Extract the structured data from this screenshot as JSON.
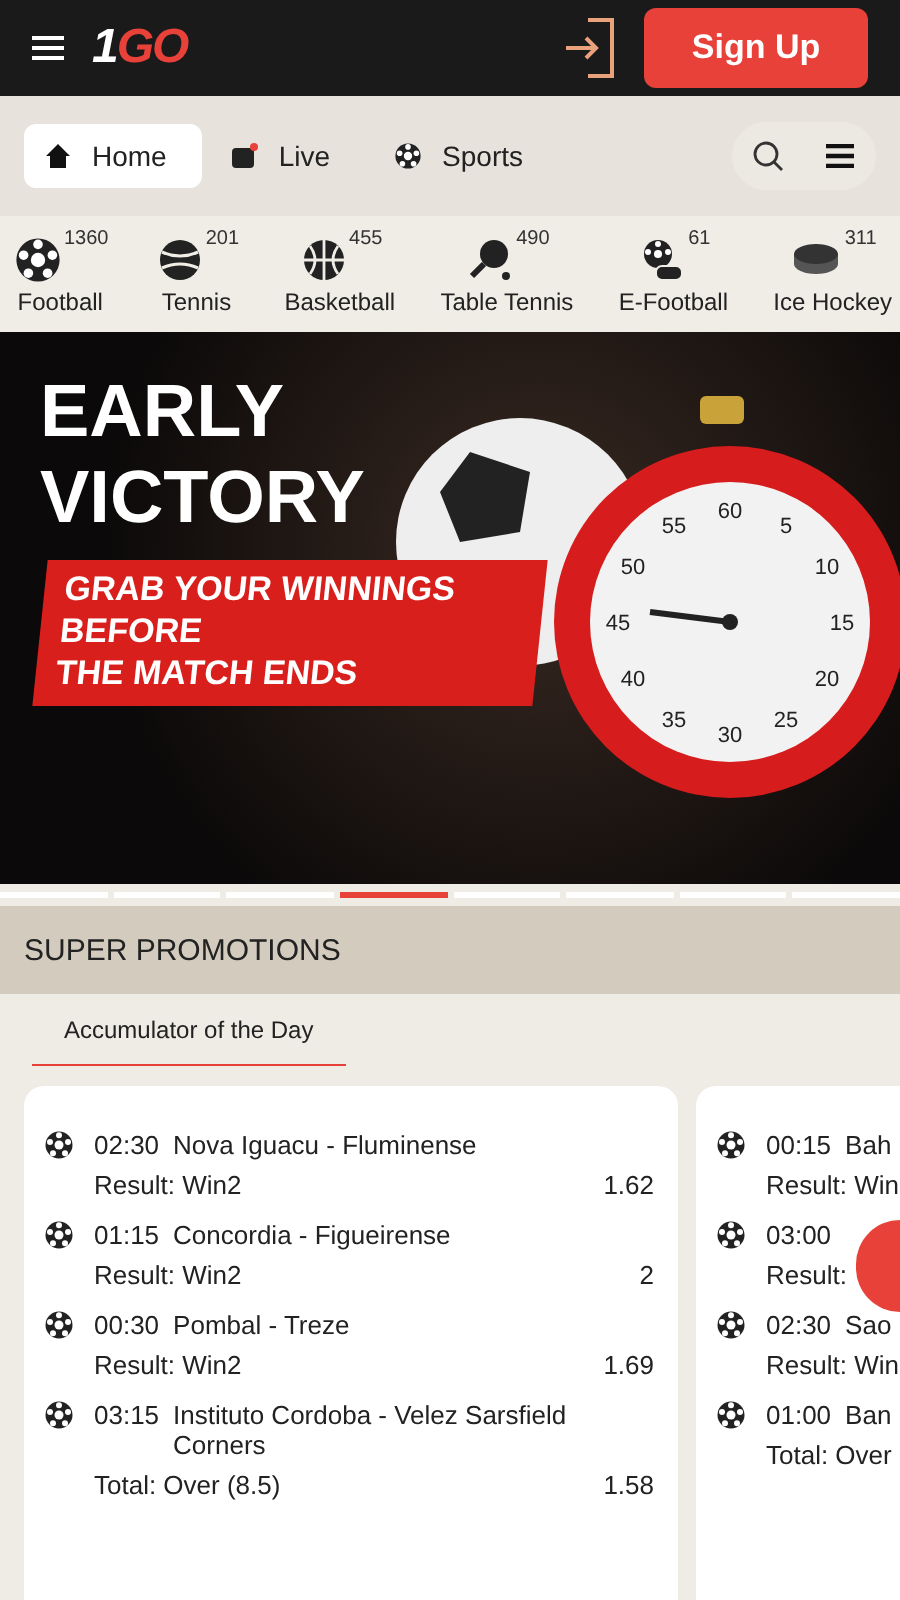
{
  "header": {
    "logo_number": "1",
    "logo_text": "GO",
    "signup": "Sign Up"
  },
  "nav": [
    {
      "label": "Home",
      "kind": "home",
      "selected": true
    },
    {
      "label": "Live",
      "kind": "live",
      "selected": false
    },
    {
      "label": "Sports",
      "kind": "sports",
      "selected": false
    }
  ],
  "sports": [
    {
      "name": "Football",
      "count": "1360",
      "kind": "football"
    },
    {
      "name": "Tennis",
      "count": "201",
      "kind": "tennis"
    },
    {
      "name": "Basketball",
      "count": "455",
      "kind": "basketball"
    },
    {
      "name": "Table Tennis",
      "count": "490",
      "kind": "tabletennis"
    },
    {
      "name": "E-Football",
      "count": "61",
      "kind": "efootball"
    },
    {
      "name": "Ice Hockey",
      "count": "311",
      "kind": "hockey"
    }
  ],
  "banner": {
    "title_lines": [
      "EARLY",
      "VICTORY"
    ],
    "tagline_lines": [
      "GRAB YOUR WINNINGS",
      "BEFORE",
      "THE MATCH ENDS"
    ],
    "dial": [
      "60",
      "5",
      "10",
      "15",
      "20",
      "25",
      "30",
      "35",
      "40",
      "45",
      "50",
      "55"
    ]
  },
  "slides": [
    {
      "selected": false
    },
    {
      "selected": false
    },
    {
      "selected": false
    },
    {
      "selected": true
    },
    {
      "selected": false
    },
    {
      "selected": false
    },
    {
      "selected": false
    },
    {
      "selected": false
    }
  ],
  "section": {
    "title": "SUPER PROMOTIONS",
    "tabs": [
      {
        "label": "Accumulator of the Day",
        "selected": true
      }
    ]
  },
  "cards": [
    {
      "events": [
        {
          "time": "02:30",
          "match": "Nova Iguacu - Fluminense",
          "bet": "Result: Win2",
          "odds": "1.62"
        },
        {
          "time": "01:15",
          "match": "Concordia - Figueirense",
          "bet": "Result: Win2",
          "odds": "2"
        },
        {
          "time": "00:30",
          "match": "Pombal - Treze",
          "bet": "Result: Win2",
          "odds": "1.69"
        },
        {
          "time": "03:15",
          "match": "Instituto Cordoba - Velez Sarsfield Corners",
          "bet": "Total: Over (8.5)",
          "odds": "1.58"
        }
      ]
    },
    {
      "events": [
        {
          "time": "00:15",
          "match": "Bah",
          "bet": "Result: Win"
        },
        {
          "time": "03:00",
          "bet": "Result:"
        },
        {
          "time": "02:30",
          "match": "Sao",
          "bet": "Result: Win"
        },
        {
          "time": "01:00",
          "match": "Ban",
          "bet": "Total: Over"
        }
      ]
    }
  ]
}
